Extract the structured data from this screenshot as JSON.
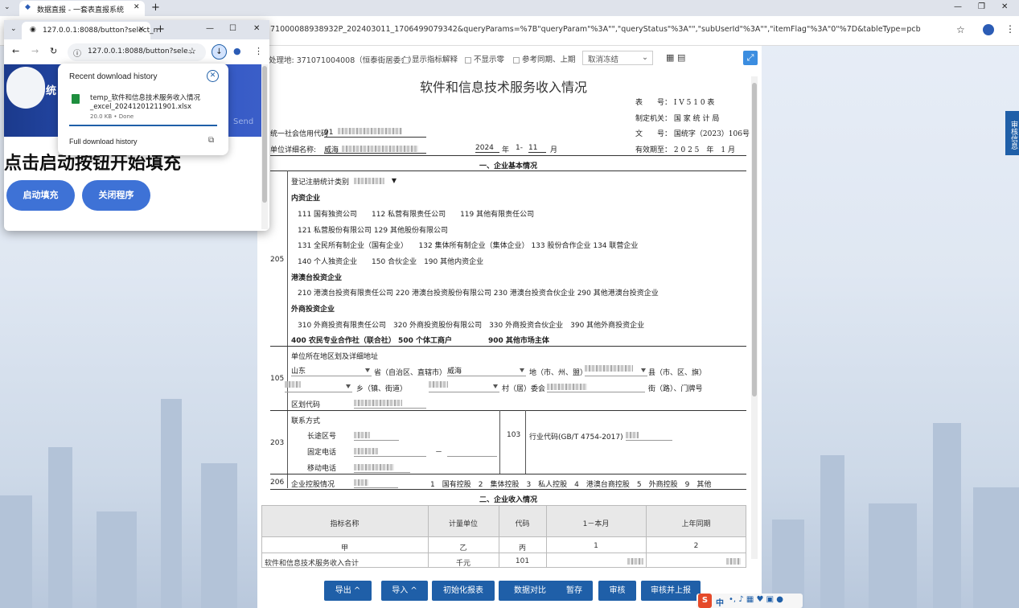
{
  "browser": {
    "tab_title": "数据直报 - 一套表直报系统",
    "url": "71000088938932P_202403011_1706499079342&queryParams=%7B\"queryParam\"%3A\"\",\"queryStatus\"%3A\"\",\"subUserId\"%3A\"\",\"itemFlag\"%3A\"0\"%7D&tableType=pcb"
  },
  "toolbar": {
    "location": "处理地: 371071004008（恒泰街居委会）",
    "opt_indicator": "显示指标解释",
    "opt_zero": "不显示零",
    "opt_compare": "参考同期、上期",
    "freeze_select": "取消冻结"
  },
  "form": {
    "title": "软件和信息技术服务收入情况",
    "meta": {
      "table_no_label": "表　　号：",
      "table_no": "I V 5 1 0 表",
      "authority_label": "制定机关：",
      "authority": "国 家 统 计 局",
      "doc_no_label": "文　　号：",
      "doc_no": "国统字（2023）106号",
      "valid_label": "有效期至：",
      "valid": "2 0 2 5　年　1 月"
    },
    "credit_code_label": "统一社会信用代码",
    "credit_code_prefix": "91",
    "unit_name_label": "单位详细名称:",
    "unit_name_prefix": "威海",
    "year": "2024",
    "year_unit": "年",
    "month_range": "1-",
    "month": "11",
    "month_unit": "月",
    "section1": "一、企业基本情况",
    "code_205": "205",
    "reg_type_label": "登记注册统计类别",
    "domestic": "内资企业",
    "dom_row1": "111 国有独资公司　　112 私营有限责任公司　　119 其他有限责任公司",
    "dom_row2": "121 私营股份有限公司 129 其他股份有限公司",
    "dom_row3": "131 全民所有制企业（国有企业）　　132 集体所有制企业（集体企业） 133 股份合作企业 134 联营企业",
    "dom_row4": "140 个人独资企业　　150 合伙企业　190 其他内资企业",
    "hmt": "港澳台投资企业",
    "hmt_row": "210 港澳台投资有限责任公司 220 港澳台投资股份有限公司 230 港澳台投资合伙企业 290 其他港澳台投资企业",
    "foreign": "外商投资企业",
    "foreign_row": "310 外商投资有限责任公司　320 外商投资股份有限公司　330 外商投资合伙企业　390 其他外商投资企业",
    "other_row": "400 农民专业合作社（联合社） 500 个体工商户　　　　　900 其他市场主体",
    "code_105": "105",
    "addr_label": "单位所在地区划及详细地址",
    "province": "山东",
    "province_suffix": "省（自治区、直辖市）",
    "city": "威海",
    "city_suffix": "地（市、州、盟）",
    "county_suffix": "县（市、区、旗）",
    "town_suffix": "乡（镇、街道）",
    "village_suffix": "村（居）委会",
    "street_suffix": "街（路）、门牌号",
    "area_code_label": "区划代码",
    "code_203": "203",
    "contact_label": "联系方式",
    "long_distance": "长途区号",
    "fixed_phone": "固定电话",
    "dash": "－",
    "mobile": "移动电话",
    "code_103": "103",
    "industry_label": "行业代码(GB/T 4754-2017)",
    "code_206": "206",
    "holding_label": "企业控股情况",
    "holding_opts": "1　国有控股　2　集体控股　3　私人控股　4　港澳台商控股　5　外商控股　9　其他",
    "section2": "二、企业收入情况",
    "table": {
      "headers": [
        "指标名称",
        "计量单位",
        "代码",
        "1－本月",
        "上年同期"
      ],
      "sub": [
        "甲",
        "乙",
        "丙",
        "1",
        "2"
      ],
      "row1": [
        "软件和信息技术服务收入合计",
        "千元",
        "101"
      ]
    }
  },
  "buttons": {
    "export": "导出 ^",
    "import": "导入 ^",
    "init": "初始化报表",
    "compare": "数据对比",
    "save": "暂存",
    "audit": "审核",
    "audit_report": "审核并上报"
  },
  "side_tab": "审核信息",
  "popup": {
    "tab_title": "127.0.0.1:8088/button?select_n",
    "url": "127.0.0.1:8088/button?sele...",
    "download_title": "Recent download history",
    "file_name_line1": "temp_软件和信息技术服务收入情况",
    "file_name_line2": "_excel_20241201211901.xlsx",
    "file_meta": "20.0 KB • Done",
    "full_history": "Full download history",
    "banner_char": "统",
    "banner_send": "Send",
    "big_text": "点击启动按钮开始填充",
    "start_btn": "启动填充",
    "close_btn": "关闭程序"
  },
  "ime": {
    "label": "中"
  }
}
